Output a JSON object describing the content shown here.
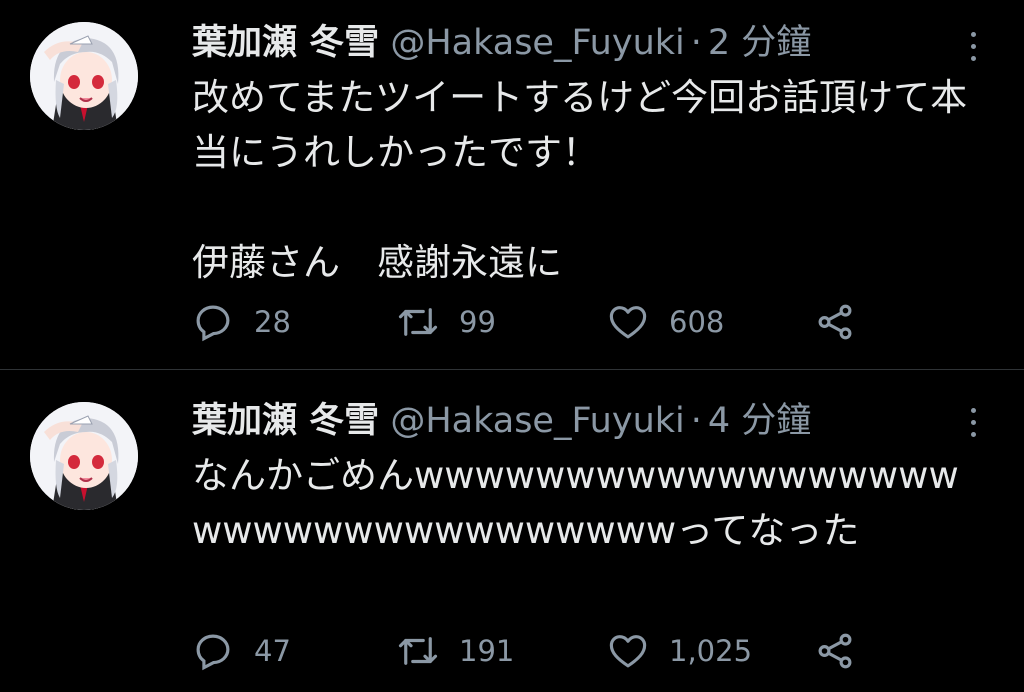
{
  "tweets": [
    {
      "author_name": "葉加瀬 冬雪",
      "handle": "@Hakase_Fuyuki",
      "separator": "·",
      "time": "2 分鐘",
      "text": "改めてまたツイートするけど今回お話頂けて本当にうれしかったです！\n\n伊藤さん　感謝永遠に",
      "replies": "28",
      "retweets": "99",
      "likes": "608"
    },
    {
      "author_name": "葉加瀬 冬雪",
      "handle": "@Hakase_Fuyuki",
      "separator": "·",
      "time": "4 分鐘",
      "text": "なんかごめんwwwwwwwwwwwwwwwwwwwwwwwwwwwwwwwwwwってなった",
      "replies": "47",
      "retweets": "191",
      "likes": "1,025"
    }
  ],
  "colors": {
    "background": "#000000",
    "primary_text": "#e7e9ea",
    "secondary_text": "#8b98a5",
    "divider": "#2f3336"
  },
  "icons": {
    "reply": "reply-icon",
    "retweet": "retweet-icon",
    "like": "heart-icon",
    "share": "share-icon",
    "more": "more-vertical-icon"
  }
}
